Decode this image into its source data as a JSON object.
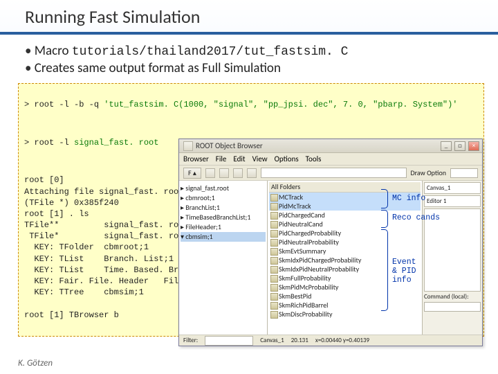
{
  "title": "Running Fast Simulation",
  "bullets": {
    "b1a": "Macro ",
    "b1b": "tutorials/thailand2017/tut_fastsim. C",
    "b2": "Creates same output format as Full Simulation"
  },
  "cmd1a": "> root -l -b -q ",
  "cmd1b": "'tut_fastsim. C(1000, \"signal\", \"pp_jpsi. dec\", 7. 0, \"pbarp. System\")'",
  "cmd2a": "> root -l ",
  "cmd2b": "signal_fast. root",
  "rootout": "root [0]\nAttaching file signal_fast. root a\n(TFile *) 0x385f240\nroot [1] . ls\nTFile**         signal_fast. root\n TFile*         signal_fast. root\n  KEY: TFolder  cbmroot;1        M\n  KEY: TList    Branch. List;1    D\n  KEY: TList    Time. Based. Branch. Li\n  KEY: Fair. File. Header   File. Heade\n  KEY: TTree    cbmsim;1         /\n\nroot [1] TBrowser b",
  "rootwin": {
    "title": "ROOT Object Browser",
    "menus": [
      "File",
      "Edit",
      "View",
      "Options",
      "Tools"
    ],
    "browser_label": "Browser",
    "draw_opt": "Draw Option",
    "tree": [
      "▸ signal_fast.root",
      "  ▸ cbmroot;1",
      "  ▸ BranchList;1",
      "  ▸ TimeBasedBranchList;1",
      "  ▸ FileHeader;1",
      "  ▾ cbmsim;1"
    ],
    "listhdr": "All Folders",
    "items": [
      "MCTrack",
      "PidMcTrack",
      "PidChargedCand",
      "PidNeutralCand",
      "PidChargedProbability",
      "PidNeutralProbability",
      "SkmEvtSummary",
      "SkmIdxPidChargedProbability",
      "SkmIdxPidNeutralProbability",
      "SkmFullProbability",
      "SkmPidMcProbability",
      "SkmBestPid",
      "SkmRichPidBarrel",
      "SkmDiscProbability"
    ],
    "tabs": {
      "canvas": "Canvas_1",
      "editor": "Editor 1"
    },
    "cmd_label": "Command (local):",
    "filter_label": "Filter:",
    "status": {
      "left": "Canvas_1",
      "mid": "20.131",
      "right": "x=0.00440 y=0.40139"
    }
  },
  "labels": {
    "mc": "MC info",
    "reco": "Reco cands",
    "event": "Event\n& PID\ninfo"
  },
  "footer": "K. Götzen"
}
